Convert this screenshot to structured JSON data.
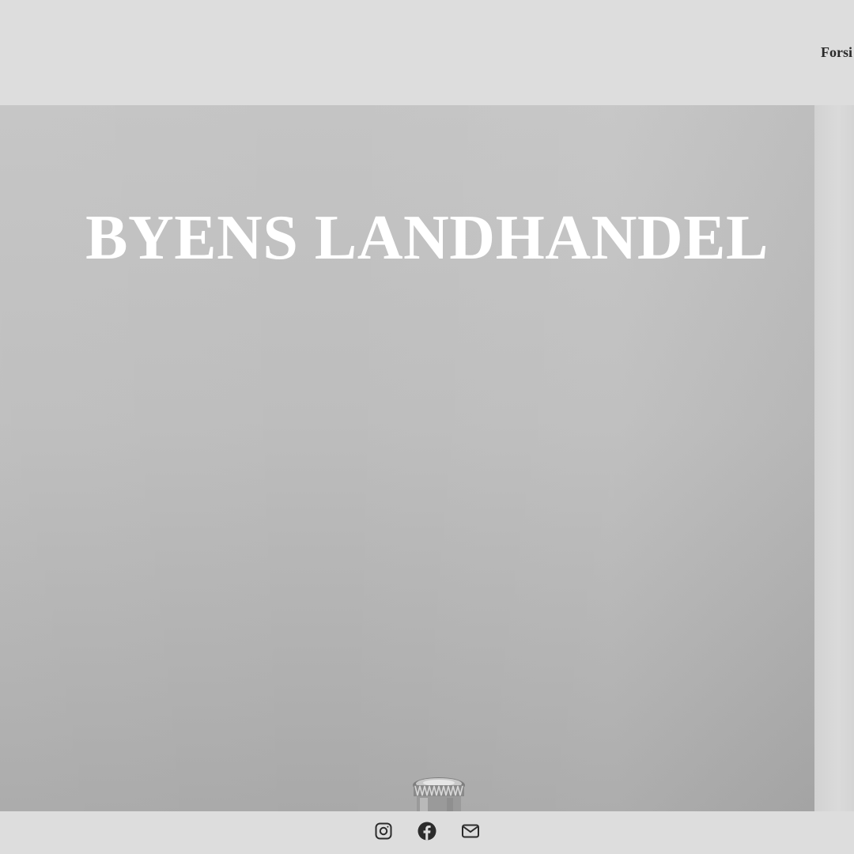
{
  "header": {
    "nav_label": "Forsi"
  },
  "hero": {
    "title": "BYENS LANDHANDEL"
  },
  "footer": {
    "social": [
      {
        "icon": "instagram-icon",
        "label": "Instagram"
      },
      {
        "icon": "facebook-icon",
        "label": "Facebook"
      },
      {
        "icon": "mail-icon",
        "label": "E-mail"
      }
    ]
  },
  "colors": {
    "header_bg": "#dddddd",
    "hero_title": "#ffffff",
    "icon": "#2b2b2b"
  }
}
